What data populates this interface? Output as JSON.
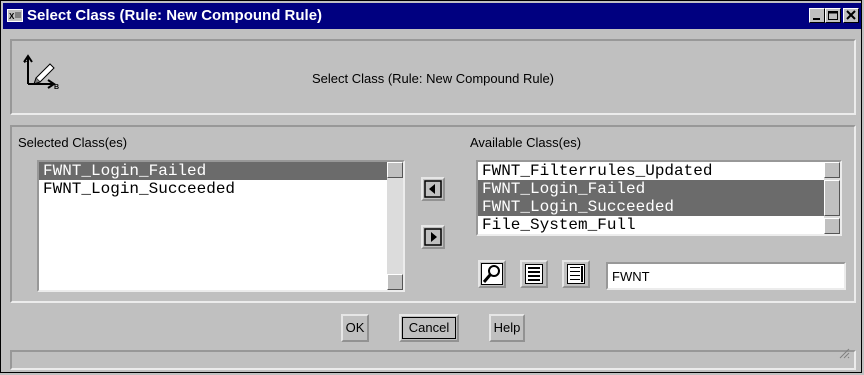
{
  "window": {
    "title": "Select Class (Rule: New Compound Rule)",
    "app_icon": "x-window-icon",
    "controls": [
      "minimize-icon",
      "maximize-icon",
      "close-icon"
    ]
  },
  "header": {
    "icon": "class-selector-icon",
    "title": "Select Class (Rule: New Compound Rule)"
  },
  "selected": {
    "label": "Selected Class(es)",
    "items": [
      "FWNT_Login_Failed",
      "FWNT_Login_Succeeded"
    ],
    "selected_index": 0
  },
  "available": {
    "label": "Available Class(es)",
    "items": [
      "FWNT_Filterrules_Updated",
      "FWNT_Login_Failed",
      "FWNT_Login_Succeeded",
      "File_System_Full"
    ],
    "selected_indices": [
      1,
      2
    ]
  },
  "transfer": {
    "add_icon": "arrow-left-icon",
    "remove_icon": "arrow-right-icon"
  },
  "tools": {
    "find_icon": "find-icon",
    "select_all_icon": "select-all-icon",
    "deselect_all_icon": "deselect-all-icon",
    "filter_value": "FWNT"
  },
  "buttons": {
    "ok": "OK",
    "cancel": "Cancel",
    "help": "Help"
  },
  "colors": {
    "title_bar": "#000080",
    "selection": "#6b6b6b",
    "face": "#c0c0c0"
  }
}
